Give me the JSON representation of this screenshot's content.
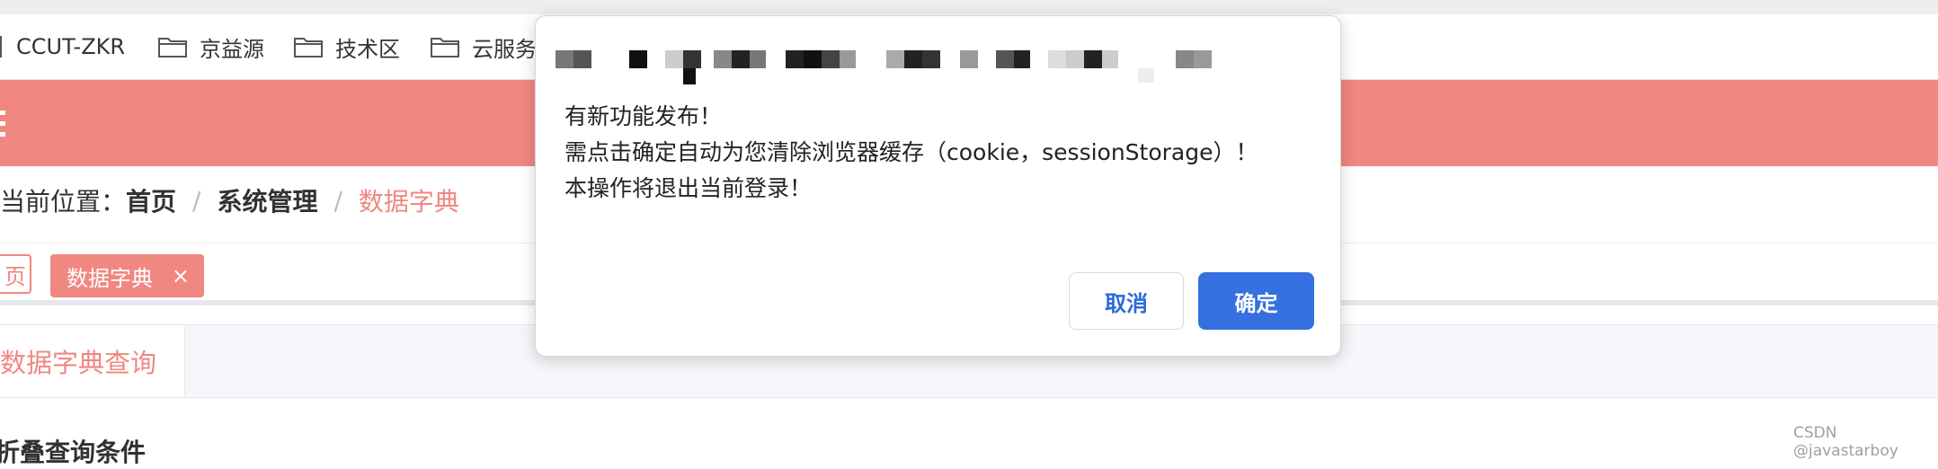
{
  "bookmarks": [
    {
      "label": "CCUT-ZKR"
    },
    {
      "label": "京益源"
    },
    {
      "label": "技术区"
    },
    {
      "label": "云服务"
    }
  ],
  "breadcrumb": {
    "prefix": "当前位置：",
    "home": "首页",
    "sep1": "/",
    "section": "系统管理",
    "sep2": "/",
    "current": "数据字典"
  },
  "tags": {
    "home_partial": "页",
    "active_label": "数据字典",
    "active_close": "×"
  },
  "tabs": {
    "query_label": "数据字典查询"
  },
  "panel": {
    "collapse_label": "折叠查询条件"
  },
  "dialog": {
    "lines": [
      "有新功能发布！",
      "需点击确定自动为您清除浏览器缓存（cookie，sessionStorage）！",
      "本操作将退出当前登录！"
    ],
    "cancel_label": "取消",
    "confirm_label": "确定"
  },
  "watermark": "CSDN @javastarboy",
  "colors": {
    "accent": "#f08781",
    "primary_button": "#3570e0",
    "cancel_text": "#2a6ad9"
  }
}
